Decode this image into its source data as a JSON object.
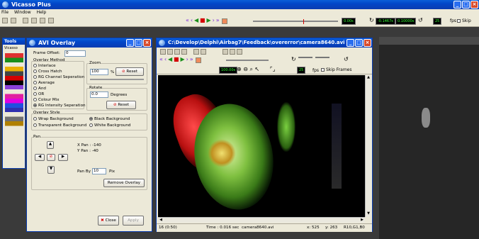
{
  "main": {
    "title": "Vicasso Plus",
    "menu": [
      "File",
      "Window",
      "Help"
    ],
    "frame_box": "0.00s",
    "box2": "-0.1467s",
    "box3": "0.10000s",
    "box4": "25",
    "fps_label": "fps",
    "skip_label": "Skip"
  },
  "tools": {
    "title": "Tools",
    "name": "Vicasso"
  },
  "avi_overlay": {
    "title": "AVI Overlay",
    "frame_offset_label": "Frame Offset:",
    "frame_offset_value": "0",
    "method_label": "Overlay Method",
    "methods": [
      "Interlace",
      "Cross Hatch",
      "RG Channel Seperation",
      "Average",
      "And",
      "OR",
      "Colour Mix",
      "RG Intensity Seperation"
    ],
    "zoom_label": "Zoom",
    "zoom_value": "100",
    "zoom_unit": "%",
    "reset_label": "Reset",
    "rotate_label": "Rotate",
    "rotate_value": "0.0",
    "degrees_label": "Degrees",
    "style_label": "Overlay Style",
    "styles": [
      "Wrap Background",
      "Black Background",
      "Transparent Background",
      "White Background"
    ],
    "pan_label": "Pan",
    "xpan": "X Pan : -140",
    "ypan": "Y Pan : -40",
    "pan_by_label": "Pan By",
    "pan_by_value": "10",
    "pan_by_unit": "Pix",
    "remove_label": "Remove Overlay",
    "close_label": "Close",
    "apply_label": "Apply"
  },
  "video": {
    "title": "C:\\Develop\\Delphi\\Airbag7\\Feedback\\overerror\\camera8640.avi",
    "time_box": "100.00s",
    "fps_value": "25",
    "fps_label": "fps",
    "skip_label": "Skip Frames",
    "status_frame": "16 (0:50)",
    "status_time": "Time : 0.016 sec",
    "status_file": "camera8640.avi",
    "status_x": "x: 525",
    "status_y": "y: 263",
    "status_rgb": "R10,G1,B0"
  },
  "colors": {
    "xp_blue": "#0a5fd8",
    "face": "#ece9d8",
    "accent_red": "#d40000",
    "accent_green": "#3f3"
  }
}
